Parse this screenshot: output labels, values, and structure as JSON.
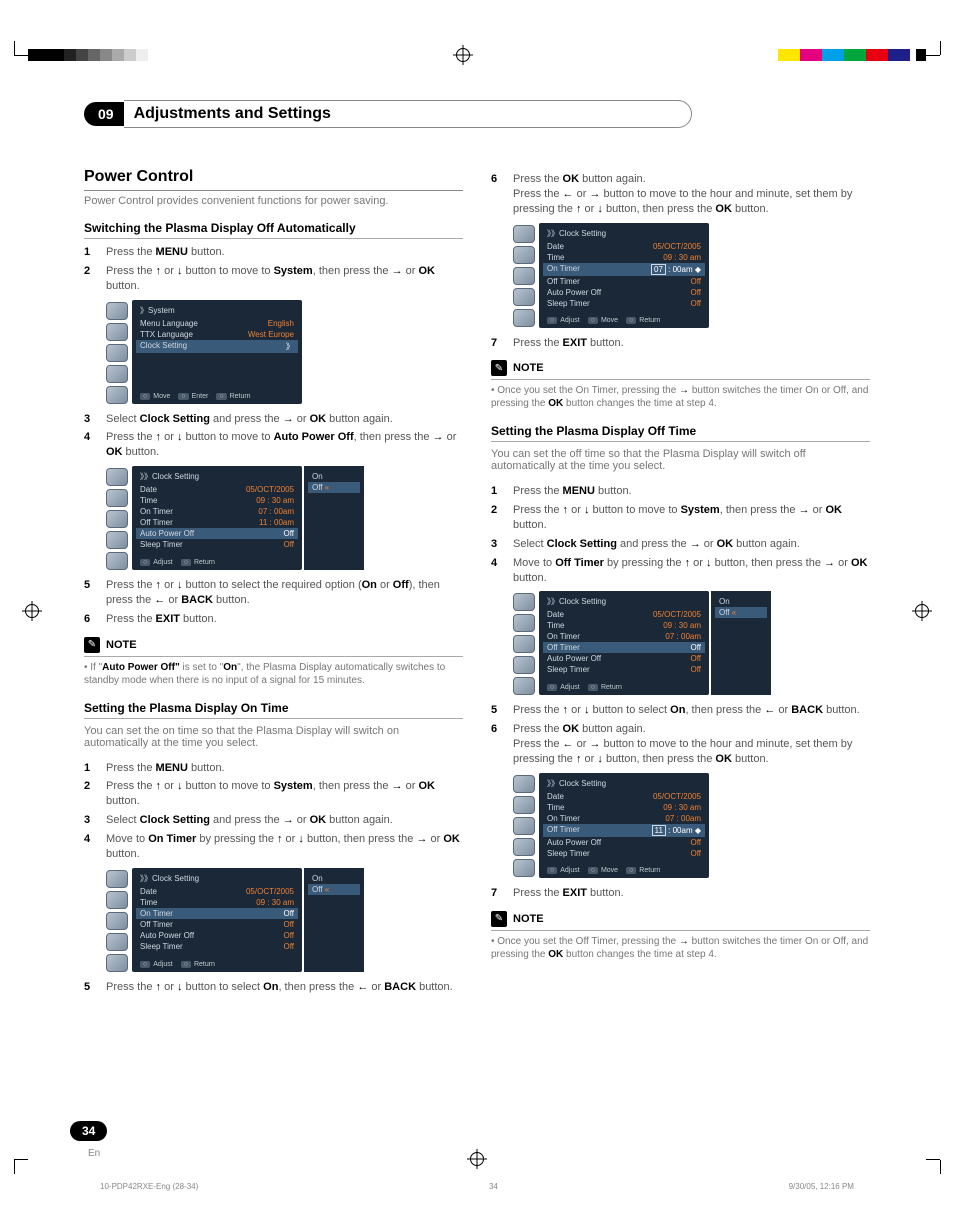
{
  "chapter": {
    "num": "09",
    "title": "Adjustments and Settings"
  },
  "page": {
    "num": "34",
    "lang": "En"
  },
  "footer": {
    "file": "10-PDP42RXE-Eng (28-34)",
    "pg": "34",
    "stamp": "9/30/05, 12:16 PM"
  },
  "left": {
    "h2": "Power Control",
    "lead": "Power Control provides convenient functions for power saving.",
    "sub_a": "Switching the Plasma Display Off Automatically",
    "a1": "Press the <b>MENU</b> button.",
    "a2": "Press the <span class='arrow'>↑</span> or <span class='arrow'>↓</span> button to move to <b>System</b>, then press the <span class='arrow'>→</span> or <b>OK</b> button.",
    "a3": "Select <b>Clock Setting</b> and press the <span class='arrow'>→</span> or <b>OK</b> button again.",
    "a4": "Press the <span class='arrow'>↑</span> or <span class='arrow'>↓</span> button to move to <b>Auto Power Off</b>, then press the <span class='arrow'>→</span> or <b>OK</b> button.",
    "a5": "Press the <span class='arrow'>↑</span> or <span class='arrow'>↓</span> button to select the required option (<b>On</b> or <b>Off</b>), then press the <span class='arrow'>←</span> or <b>BACK</b> button.",
    "a6": "Press the <b>EXIT</b> button.",
    "note_a": "If \"<b>Auto Power Off\"</b> is set to \"<b>On</b>\", the Plasma Display automatically switches to standby mode when there is no input of a signal for 15 minutes.",
    "sub_b": "Setting the Plasma Display On Time",
    "lead_b": "You can set the on time so that the Plasma Display will switch on automatically at the time you select.",
    "b1": "Press the <b>MENU</b> button.",
    "b2": "Press the <span class='arrow'>↑</span> or <span class='arrow'>↓</span> button to move to <b>System</b>, then press the <span class='arrow'>→</span> or <b>OK</b> button.",
    "b3": "Select <b>Clock Setting</b> and press the <span class='arrow'>→</span> or <b>OK</b> button again.",
    "b4": "Move to <b>On Timer</b> by pressing the <span class='arrow'>↑</span> or <span class='arrow'>↓</span> button, then press the <span class='arrow'>→</span> or <b>OK</b> button.",
    "b5": "Press the <span class='arrow'>↑</span> or <span class='arrow'>↓</span> button to select <b>On</b>, then press the <span class='arrow'>←</span> or <b>BACK</b> button."
  },
  "right": {
    "r6": "Press the <b>OK</b> button again.<br>Press the <span class='arrow'>←</span> or <span class='arrow'>→</span> button to move to the hour and minute, set them by pressing the <span class='arrow'>↑</span> or <span class='arrow'>↓</span> button, then press the <b>OK</b> button.",
    "r7": "Press the <b>EXIT</b> button.",
    "note_r": "Once you set the On Timer, pressing the <span class='arrow'>→</span> button switches the timer On or Off, and pressing the <b>OK</b> button changes the time at step 4.",
    "sub_c": "Setting the Plasma Display Off Time",
    "lead_c": "You can set the off time so that the Plasma Display will switch off automatically at the time you select.",
    "c1": "Press the <b>MENU</b> button.",
    "c2": "Press the <span class='arrow'>↑</span> or <span class='arrow'>↓</span> button to move to <b>System</b>, then press the <span class='arrow'>→</span> or <b>OK</b> button.",
    "c3": "Select <b>Clock Setting</b> and press the <span class='arrow'>→</span> or <b>OK</b> button again.",
    "c4": "Move to <b>Off Timer</b> by pressing the <span class='arrow'>↑</span> or <span class='arrow'>↓</span> button, then press the <span class='arrow'>→</span> or <b>OK</b> button.",
    "c5": "Press the <span class='arrow'>↑</span> or <span class='arrow'>↓</span> button to select <b>On</b>, then press the <span class='arrow'>←</span> or <b>BACK</b> button.",
    "c6": "Press the <b>OK</b> button again.<br>Press the <span class='arrow'>←</span> or <span class='arrow'>→</span> button to move to the hour and minute, set them by pressing the <span class='arrow'>↑</span> or <span class='arrow'>↓</span> button, then press the <b>OK</b> button.",
    "c7": "Press the <b>EXIT</b> button.",
    "note_c": "Once you set the Off Timer, pressing the <span class='arrow'>→</span> button switches the timer On or Off, and pressing the <b>OK</b> button changes the time at step 4."
  },
  "ui": {
    "note_label": "NOTE",
    "move": "Move",
    "enter": "Enter",
    "return": "Return",
    "adjust": "Adjust",
    "back": "BACK",
    "ok": "OK"
  },
  "osd": {
    "system": {
      "title": "》System",
      "rows": [
        {
          "k": "Menu Language",
          "v": "English"
        },
        {
          "k": "TTX Language",
          "v": "West Europe"
        },
        {
          "k": "Clock Setting",
          "v": "》",
          "sel": true
        }
      ],
      "foot": [
        "Move",
        "Enter",
        "Return"
      ]
    },
    "clock_apo": {
      "title": "》》Clock Setting",
      "rows": [
        {
          "k": "Date",
          "v": "05/OCT/2005"
        },
        {
          "k": "Time",
          "v": "09 : 30 am"
        },
        {
          "k": "On Timer",
          "v": "07 : 00am"
        },
        {
          "k": "Off Timer",
          "v": "11 : 00am"
        },
        {
          "k": "Auto Power Off",
          "v": "Off",
          "sel": true
        },
        {
          "k": "Sleep Timer",
          "v": "Off"
        }
      ],
      "sub": [
        "On",
        "Off"
      ],
      "subsel": 1,
      "foot": [
        "Adjust",
        "Return"
      ]
    },
    "clock_on": {
      "title": "》》Clock Setting",
      "rows": [
        {
          "k": "Date",
          "v": "05/OCT/2005"
        },
        {
          "k": "Time",
          "v": "09 : 30 am"
        },
        {
          "k": "On Timer",
          "v": "Off",
          "sel": true
        },
        {
          "k": "Off Timer",
          "v": "Off"
        },
        {
          "k": "Auto Power Off",
          "v": "Off"
        },
        {
          "k": "Sleep Timer",
          "v": "Off"
        }
      ],
      "sub": [
        "On",
        "Off"
      ],
      "subsel": 1,
      "foot": [
        "Adjust",
        "Return"
      ]
    },
    "clock_on_hour": {
      "title": "》》Clock Setting",
      "rows": [
        {
          "k": "Date",
          "v": "05/OCT/2005"
        },
        {
          "k": "Time",
          "v": "09 : 30 am"
        },
        {
          "k": "On Timer",
          "v": "07 : 00am ◆",
          "sel": true,
          "boxstart": "07"
        },
        {
          "k": "Off Timer",
          "v": "Off"
        },
        {
          "k": "Auto Power Off",
          "v": "Off"
        },
        {
          "k": "Sleep Timer",
          "v": "Off"
        }
      ],
      "foot": [
        "Adjust",
        "Move",
        "Return"
      ]
    },
    "clock_off": {
      "title": "》》Clock Setting",
      "rows": [
        {
          "k": "Date",
          "v": "05/OCT/2005"
        },
        {
          "k": "Time",
          "v": "09 : 30 am"
        },
        {
          "k": "On Timer",
          "v": "07 : 00am"
        },
        {
          "k": "Off Timer",
          "v": "Off",
          "sel": true
        },
        {
          "k": "Auto Power Off",
          "v": "Off"
        },
        {
          "k": "Sleep Timer",
          "v": "Off"
        }
      ],
      "sub": [
        "On",
        "Off"
      ],
      "subsel": 1,
      "foot": [
        "Adjust",
        "Return"
      ]
    },
    "clock_off_hour": {
      "title": "》》Clock Setting",
      "rows": [
        {
          "k": "Date",
          "v": "05/OCT/2005"
        },
        {
          "k": "Time",
          "v": "09 : 30 am"
        },
        {
          "k": "On Timer",
          "v": "07 : 00am"
        },
        {
          "k": "Off Timer",
          "v": "11 : 00am ◆",
          "sel": true,
          "boxstart": "11"
        },
        {
          "k": "Auto Power Off",
          "v": "Off"
        },
        {
          "k": "Sleep Timer",
          "v": "Off"
        }
      ],
      "foot": [
        "Adjust",
        "Move",
        "Return"
      ]
    }
  }
}
